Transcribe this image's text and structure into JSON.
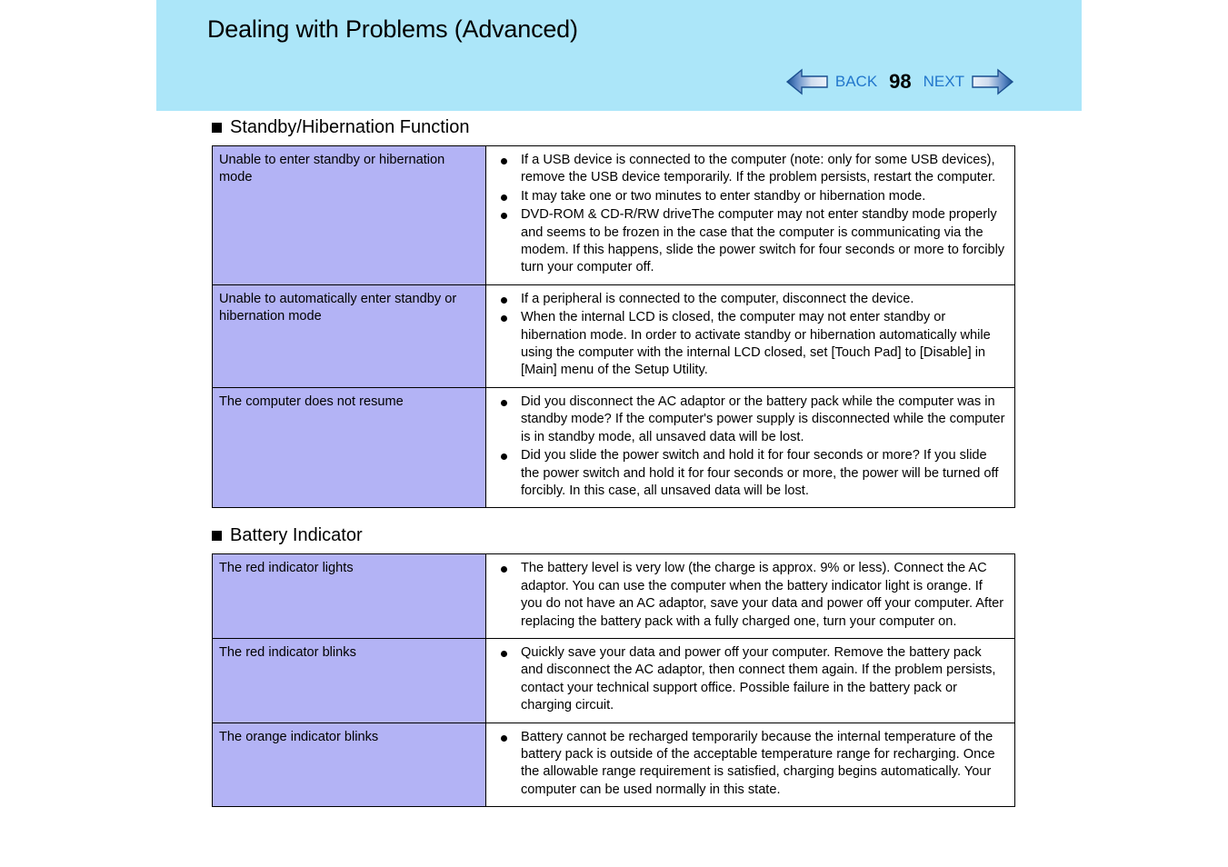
{
  "header": {
    "title": "Dealing with Problems (Advanced)",
    "banner_color": "#ace6f9",
    "nav": {
      "back_label": "BACK",
      "page_number": "98",
      "next_label": "NEXT",
      "back_icon": "left-arrow-icon",
      "next_icon": "right-arrow-icon",
      "link_color": "#2277cc"
    }
  },
  "sections": [
    {
      "heading": "Standby/Hibernation Function",
      "rows": [
        {
          "label": "Unable to enter standby or hibernation mode",
          "bullets": [
            "If a USB device is connected to the computer (note: only for some USB devices), remove the USB device temporarily.  If the problem persists, restart the computer.",
            "It may take one or two minutes to enter standby or hibernation mode.",
            "DVD-ROM & CD-R/RW driveThe computer may not enter standby mode properly and seems to be frozen in the case that the computer is communicating via the modem. If this happens, slide the power switch for four seconds or more to forcibly turn your computer off."
          ]
        },
        {
          "label": "Unable to automatically enter standby or hibernation mode",
          "bullets": [
            "If a peripheral is connected to the computer, disconnect the device.",
            "When the internal LCD is closed, the computer may not enter standby or hibernation mode. In order to activate standby or hibernation automatically while using the computer with the internal LCD closed, set [Touch Pad] to [Disable] in [Main] menu of the Setup Utility."
          ]
        },
        {
          "label": "The computer does not resume",
          "bullets": [
            "Did you disconnect the AC adaptor or the battery pack while the computer was in standby mode? If the computer's power supply is disconnected while the computer is in standby mode, all unsaved data will be lost.",
            "Did you slide the power switch and hold it for four seconds or more? If you slide the power switch and hold it for four seconds or more, the power will be turned off forcibly.   In this case, all unsaved data will be lost."
          ]
        }
      ]
    },
    {
      "heading": "Battery Indicator",
      "rows": [
        {
          "label": "The red indicator lights",
          "bullets": [
            "The battery level is very low (the charge is approx. 9% or less). Connect the AC adaptor.  You can use the computer when the battery indicator light is orange.   If you do not have an AC adaptor, save your data and power off your computer. After replacing the battery pack with a fully charged one, turn your computer on."
          ]
        },
        {
          "label": "The red indicator blinks",
          "bullets": [
            "Quickly save your data and power off your computer.  Remove the battery pack and disconnect the AC adaptor, then connect them again. If the problem persists, contact your technical support office. Possible failure in the battery pack or charging circuit."
          ]
        },
        {
          "label": "The orange indicator blinks",
          "bullets": [
            "Battery cannot be recharged temporarily because the internal temperature of the battery pack is outside of the acceptable temperature range for recharging. Once the allowable range requirement is satisfied, charging begins automatically.  Your computer can be used normally in this state."
          ]
        }
      ]
    }
  ],
  "colors": {
    "label_cell_background": "#b3b3f5",
    "banner": "#ace6f9",
    "nav_link": "#2277cc",
    "arrow_dark": "#1a4f8f",
    "arrow_light": "#e8eef8"
  }
}
